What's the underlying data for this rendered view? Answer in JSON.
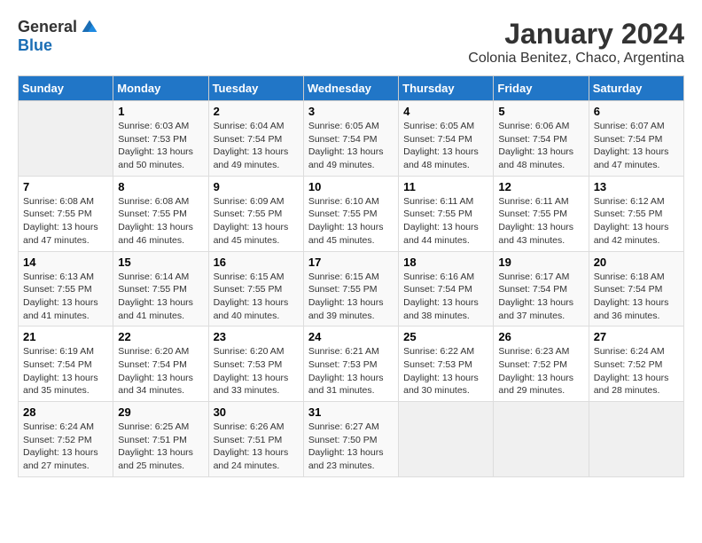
{
  "logo": {
    "general": "General",
    "blue": "Blue"
  },
  "title": {
    "month_year": "January 2024",
    "location": "Colonia Benitez, Chaco, Argentina"
  },
  "days_of_week": [
    "Sunday",
    "Monday",
    "Tuesday",
    "Wednesday",
    "Thursday",
    "Friday",
    "Saturday"
  ],
  "weeks": [
    [
      {
        "day": "",
        "sunrise": "",
        "sunset": "",
        "daylight": "",
        "empty": true
      },
      {
        "day": "1",
        "sunrise": "6:03 AM",
        "sunset": "7:53 PM",
        "daylight": "13 hours and 50 minutes."
      },
      {
        "day": "2",
        "sunrise": "6:04 AM",
        "sunset": "7:54 PM",
        "daylight": "13 hours and 49 minutes."
      },
      {
        "day": "3",
        "sunrise": "6:05 AM",
        "sunset": "7:54 PM",
        "daylight": "13 hours and 49 minutes."
      },
      {
        "day": "4",
        "sunrise": "6:05 AM",
        "sunset": "7:54 PM",
        "daylight": "13 hours and 48 minutes."
      },
      {
        "day": "5",
        "sunrise": "6:06 AM",
        "sunset": "7:54 PM",
        "daylight": "13 hours and 48 minutes."
      },
      {
        "day": "6",
        "sunrise": "6:07 AM",
        "sunset": "7:54 PM",
        "daylight": "13 hours and 47 minutes."
      }
    ],
    [
      {
        "day": "7",
        "sunrise": "6:08 AM",
        "sunset": "7:55 PM",
        "daylight": "13 hours and 47 minutes."
      },
      {
        "day": "8",
        "sunrise": "6:08 AM",
        "sunset": "7:55 PM",
        "daylight": "13 hours and 46 minutes."
      },
      {
        "day": "9",
        "sunrise": "6:09 AM",
        "sunset": "7:55 PM",
        "daylight": "13 hours and 45 minutes."
      },
      {
        "day": "10",
        "sunrise": "6:10 AM",
        "sunset": "7:55 PM",
        "daylight": "13 hours and 45 minutes."
      },
      {
        "day": "11",
        "sunrise": "6:11 AM",
        "sunset": "7:55 PM",
        "daylight": "13 hours and 44 minutes."
      },
      {
        "day": "12",
        "sunrise": "6:11 AM",
        "sunset": "7:55 PM",
        "daylight": "13 hours and 43 minutes."
      },
      {
        "day": "13",
        "sunrise": "6:12 AM",
        "sunset": "7:55 PM",
        "daylight": "13 hours and 42 minutes."
      }
    ],
    [
      {
        "day": "14",
        "sunrise": "6:13 AM",
        "sunset": "7:55 PM",
        "daylight": "13 hours and 41 minutes."
      },
      {
        "day": "15",
        "sunrise": "6:14 AM",
        "sunset": "7:55 PM",
        "daylight": "13 hours and 41 minutes."
      },
      {
        "day": "16",
        "sunrise": "6:15 AM",
        "sunset": "7:55 PM",
        "daylight": "13 hours and 40 minutes."
      },
      {
        "day": "17",
        "sunrise": "6:15 AM",
        "sunset": "7:55 PM",
        "daylight": "13 hours and 39 minutes."
      },
      {
        "day": "18",
        "sunrise": "6:16 AM",
        "sunset": "7:54 PM",
        "daylight": "13 hours and 38 minutes."
      },
      {
        "day": "19",
        "sunrise": "6:17 AM",
        "sunset": "7:54 PM",
        "daylight": "13 hours and 37 minutes."
      },
      {
        "day": "20",
        "sunrise": "6:18 AM",
        "sunset": "7:54 PM",
        "daylight": "13 hours and 36 minutes."
      }
    ],
    [
      {
        "day": "21",
        "sunrise": "6:19 AM",
        "sunset": "7:54 PM",
        "daylight": "13 hours and 35 minutes."
      },
      {
        "day": "22",
        "sunrise": "6:20 AM",
        "sunset": "7:54 PM",
        "daylight": "13 hours and 34 minutes."
      },
      {
        "day": "23",
        "sunrise": "6:20 AM",
        "sunset": "7:53 PM",
        "daylight": "13 hours and 33 minutes."
      },
      {
        "day": "24",
        "sunrise": "6:21 AM",
        "sunset": "7:53 PM",
        "daylight": "13 hours and 31 minutes."
      },
      {
        "day": "25",
        "sunrise": "6:22 AM",
        "sunset": "7:53 PM",
        "daylight": "13 hours and 30 minutes."
      },
      {
        "day": "26",
        "sunrise": "6:23 AM",
        "sunset": "7:52 PM",
        "daylight": "13 hours and 29 minutes."
      },
      {
        "day": "27",
        "sunrise": "6:24 AM",
        "sunset": "7:52 PM",
        "daylight": "13 hours and 28 minutes."
      }
    ],
    [
      {
        "day": "28",
        "sunrise": "6:24 AM",
        "sunset": "7:52 PM",
        "daylight": "13 hours and 27 minutes."
      },
      {
        "day": "29",
        "sunrise": "6:25 AM",
        "sunset": "7:51 PM",
        "daylight": "13 hours and 25 minutes."
      },
      {
        "day": "30",
        "sunrise": "6:26 AM",
        "sunset": "7:51 PM",
        "daylight": "13 hours and 24 minutes."
      },
      {
        "day": "31",
        "sunrise": "6:27 AM",
        "sunset": "7:50 PM",
        "daylight": "13 hours and 23 minutes."
      },
      {
        "day": "",
        "sunrise": "",
        "sunset": "",
        "daylight": "",
        "empty": true
      },
      {
        "day": "",
        "sunrise": "",
        "sunset": "",
        "daylight": "",
        "empty": true
      },
      {
        "day": "",
        "sunrise": "",
        "sunset": "",
        "daylight": "",
        "empty": true
      }
    ]
  ],
  "labels": {
    "sunrise": "Sunrise:",
    "sunset": "Sunset:",
    "daylight": "Daylight:"
  }
}
